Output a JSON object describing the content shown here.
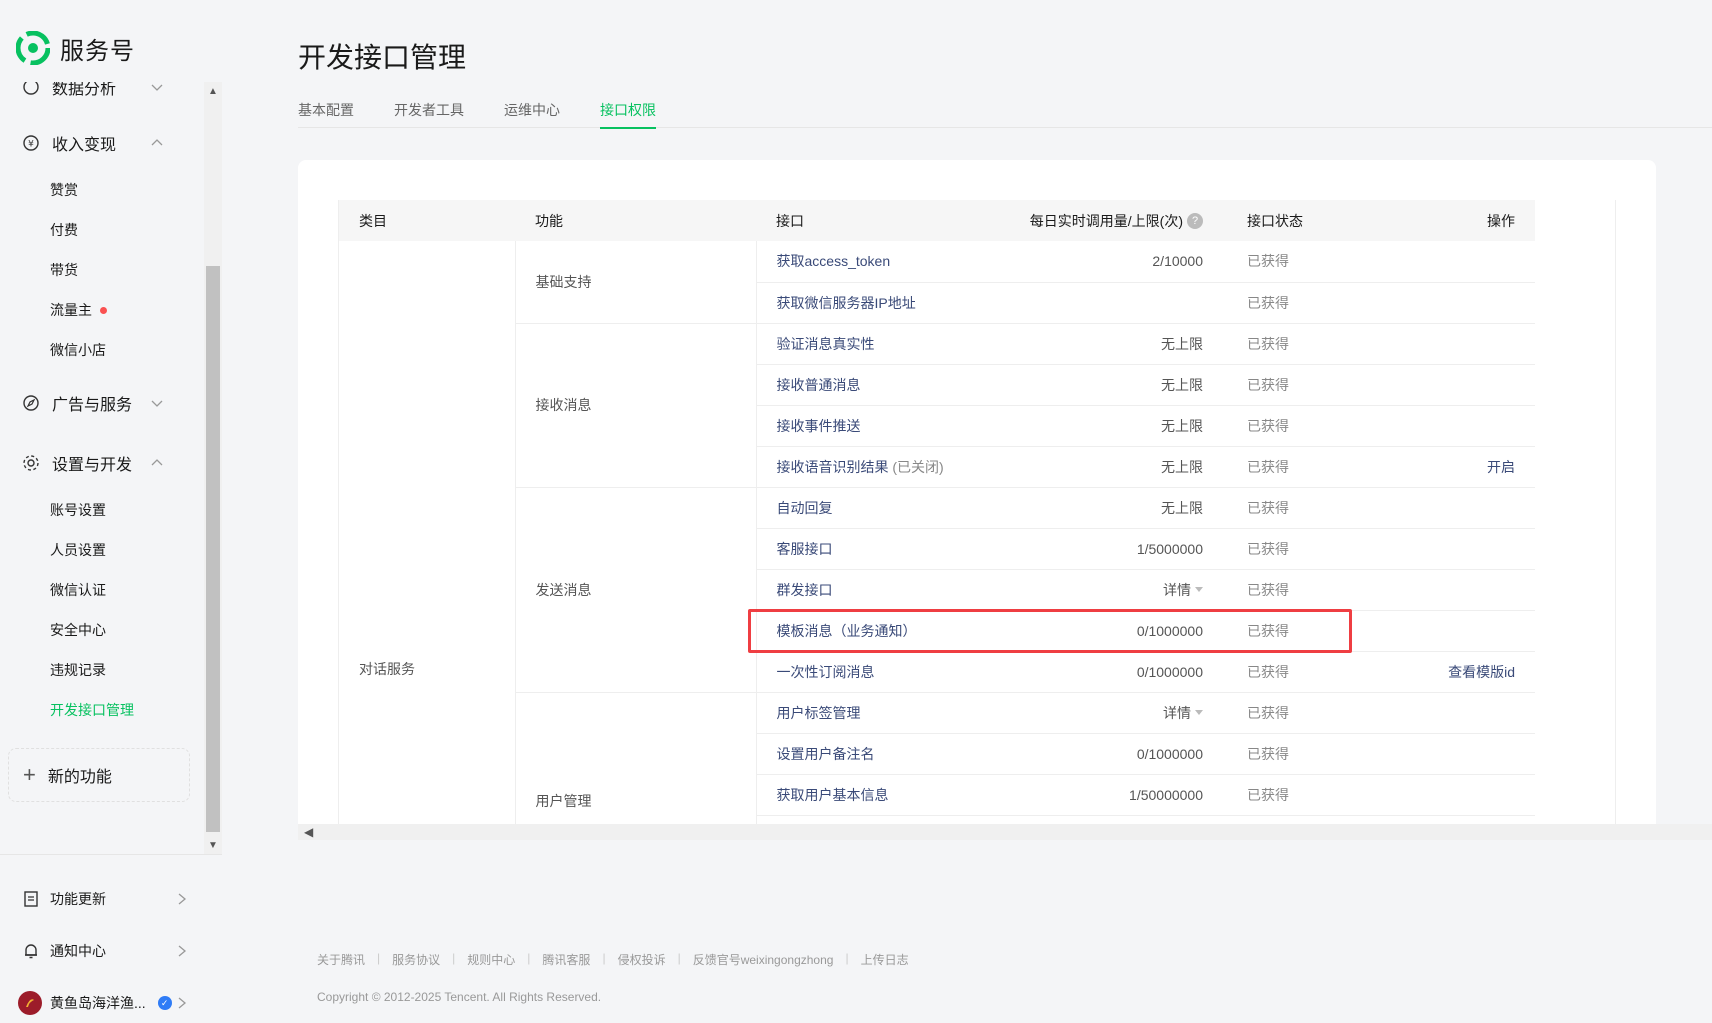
{
  "brand": {
    "name": "服务号"
  },
  "sidebar": {
    "partial_group": "数据分析",
    "groups": [
      {
        "label": "收入变现",
        "items": [
          "赞赏",
          "付费",
          "带货",
          "流量主",
          "微信小店"
        ]
      },
      {
        "label": "广告与服务",
        "items": []
      },
      {
        "label": "设置与开发",
        "items": [
          "账号设置",
          "人员设置",
          "微信认证",
          "安全中心",
          "违规记录",
          "开发接口管理"
        ]
      }
    ],
    "active_item": "开发接口管理",
    "new_feature": "新的功能",
    "bottom": {
      "updates": "功能更新",
      "notifications": "通知中心",
      "account": "黄鱼岛海洋渔..."
    }
  },
  "main": {
    "title": "开发接口管理",
    "tabs": [
      "基本配置",
      "开发者工具",
      "运维中心",
      "接口权限"
    ],
    "active_tab": "接口权限"
  },
  "table": {
    "headers": {
      "category": "类目",
      "function": "功能",
      "interface": "接口",
      "usage": "每日实时调用量/上限(次)",
      "status": "接口状态",
      "operation": "操作"
    },
    "category": "对话服务",
    "functions": {
      "basic": "基础支持",
      "receive": "接收消息",
      "send": "发送消息",
      "user": "用户管理"
    },
    "rows": [
      {
        "name": "获取access_token",
        "usage": "2/10000",
        "status": "已获得",
        "op": ""
      },
      {
        "name": "获取微信服务器IP地址",
        "usage": "",
        "status": "已获得",
        "op": ""
      },
      {
        "name": "验证消息真实性",
        "usage": "无上限",
        "status": "已获得",
        "op": ""
      },
      {
        "name": "接收普通消息",
        "usage": "无上限",
        "status": "已获得",
        "op": ""
      },
      {
        "name": "接收事件推送",
        "usage": "无上限",
        "status": "已获得",
        "op": ""
      },
      {
        "name": "接收语音识别结果",
        "suffix": "(已关闭)",
        "usage": "无上限",
        "status": "已获得",
        "op": "开启"
      },
      {
        "name": "自动回复",
        "usage": "无上限",
        "status": "已获得",
        "op": ""
      },
      {
        "name": "客服接口",
        "usage": "1/5000000",
        "status": "已获得",
        "op": ""
      },
      {
        "name": "群发接口",
        "usage": "详情",
        "status": "已获得",
        "op": ""
      },
      {
        "name": "模板消息（业务通知）",
        "usage": "0/1000000",
        "status": "已获得",
        "op": ""
      },
      {
        "name": "一次性订阅消息",
        "usage": "0/1000000",
        "status": "已获得",
        "op": "查看模版id"
      },
      {
        "name": "用户标签管理",
        "usage": "详情",
        "status": "已获得",
        "op": ""
      },
      {
        "name": "设置用户备注名",
        "usage": "0/1000000",
        "status": "已获得",
        "op": ""
      },
      {
        "name": "获取用户基本信息",
        "usage": "1/50000000",
        "status": "已获得",
        "op": ""
      }
    ]
  },
  "footer": {
    "links": [
      "关于腾讯",
      "服务协议",
      "规则中心",
      "腾讯客服",
      "侵权投诉",
      "反馈官号weixingongzhong",
      "上传日志"
    ],
    "copyright": "Copyright © 2012-2025 Tencent. All Rights Reserved."
  },
  "colors": {
    "accent": "#07c160",
    "link": "#3a4a78",
    "highlight": "#ef3e42",
    "dot": "#fa5151"
  }
}
